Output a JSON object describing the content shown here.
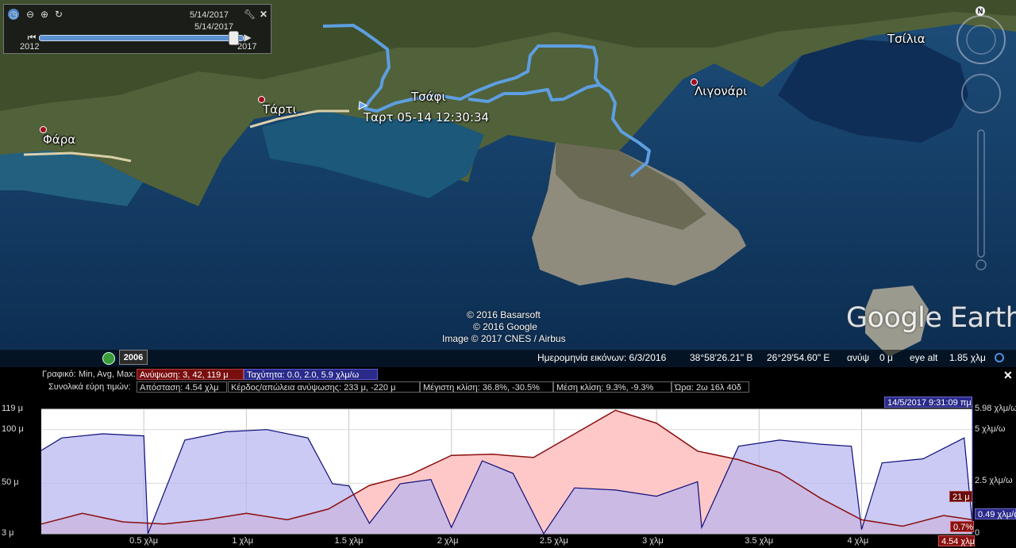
{
  "map": {
    "places": [
      {
        "name": "Φάρα"
      },
      {
        "name": "Τάρτι"
      },
      {
        "name": "Τσάφι"
      },
      {
        "name": "Λιγονάρι"
      },
      {
        "name": "Τσίλια"
      }
    ],
    "track_label": "Ταρτ 05-14 12:30:34",
    "credits": [
      "© 2016 Basarsoft",
      "© 2016 Google",
      "Image © 2017 CNES / Airbus"
    ],
    "logo": "Google Earth",
    "compass_north": "N"
  },
  "time_slider": {
    "date_top": "5/14/2017",
    "date_thumb": "5/14/2017",
    "year_start": "2012",
    "year_end": "2017",
    "historical_year": "2006"
  },
  "status_bar": {
    "imagery_date": "Ημερομηνία εικόνων: 6/3/2016",
    "lat": "38°58'26.21\" Β",
    "lon": "26°29'54.60\" Ε",
    "elev_label": "ανύψ",
    "elev_value": "0 μ",
    "eye_alt_label": "eye alt",
    "eye_alt_value": "1.85 χλμ"
  },
  "profile": {
    "graph_label": "Γραφικό: Min, Avg, Max:",
    "elevation_stats": "Ανύψωση: 3, 42, 119 μ",
    "speed_stats": "Ταχύτητα: 0.0, 2.0, 5.9 χλμ/ω",
    "totals_label": "Συνολικά εύρη τιμών:",
    "distance": "Απόσταση: 4.54 χλμ",
    "gain_loss": "Κέρδος/απώλεια ανύψωσης: 233 μ, -220 μ",
    "max_slope": "Μέγιστη κλίση: 36.8%, -30.5%",
    "avg_slope": "Μέση κλίση: 9.3%, -9.3%",
    "time": "Ώρα: 2ω 16λ 40δ",
    "cursor_time": "14/5/2017 9:31:09 πμ",
    "cursor_elev": "21 μ",
    "cursor_slope": "0.7%",
    "cursor_dist": "4.54 χλμ",
    "cursor_speed": "0.49 χλμ/ω",
    "close": "✕",
    "colors": {
      "elevation": "#8b0d0d",
      "elevation_fill": "#ffc8c8",
      "speed": "#0d0d7a",
      "speed_fill": "#b4b4f0"
    }
  },
  "chart_data": {
    "type": "area",
    "x_unit": "χλμ",
    "xlim": [
      0,
      4.54
    ],
    "x_ticks": [
      "0.5 χλμ",
      "1 χλμ",
      "1.5 χλμ",
      "2 χλμ",
      "2.5 χλμ",
      "3 χλμ",
      "3.5 χλμ",
      "4 χλμ"
    ],
    "y_left_ticks": [
      "119 μ",
      "100 μ",
      "50 μ",
      "3 μ"
    ],
    "y_right_ticks": [
      "5.98 χλμ/ω",
      "5 χλμ/ω",
      "2.5 χλμ/ω",
      "0"
    ],
    "ylim_left": [
      3,
      119
    ],
    "ylim_right": [
      0,
      5.98
    ],
    "series": [
      {
        "name": "Ανύψωση",
        "axis": "left",
        "x": [
          0,
          0.2,
          0.4,
          0.6,
          0.8,
          1.0,
          1.2,
          1.4,
          1.6,
          1.8,
          2.0,
          2.2,
          2.4,
          2.6,
          2.8,
          3.0,
          3.2,
          3.4,
          3.6,
          3.8,
          4.0,
          4.2,
          4.4,
          4.54
        ],
        "values": [
          12,
          22,
          14,
          12,
          16,
          22,
          16,
          26,
          48,
          58,
          76,
          77,
          74,
          96,
          118,
          106,
          80,
          72,
          60,
          36,
          16,
          10,
          20,
          16
        ]
      },
      {
        "name": "Ταχύτητα",
        "axis": "right",
        "x": [
          0,
          0.1,
          0.3,
          0.5,
          0.52,
          0.7,
          0.9,
          1.1,
          1.3,
          1.42,
          1.5,
          1.6,
          1.75,
          1.9,
          2.0,
          2.15,
          2.3,
          2.45,
          2.6,
          2.8,
          3.0,
          3.2,
          3.22,
          3.4,
          3.6,
          3.8,
          3.95,
          4.0,
          4.1,
          4.3,
          4.5,
          4.54
        ],
        "values": [
          4.0,
          4.6,
          4.8,
          4.7,
          0.0,
          4.5,
          4.9,
          5.0,
          4.6,
          2.4,
          2.3,
          0.5,
          2.4,
          2.6,
          0.3,
          3.5,
          2.9,
          0.0,
          2.2,
          2.1,
          1.8,
          2.5,
          0.3,
          4.2,
          4.5,
          4.3,
          4.2,
          0.2,
          3.4,
          3.6,
          4.6,
          0.5
        ]
      }
    ]
  }
}
